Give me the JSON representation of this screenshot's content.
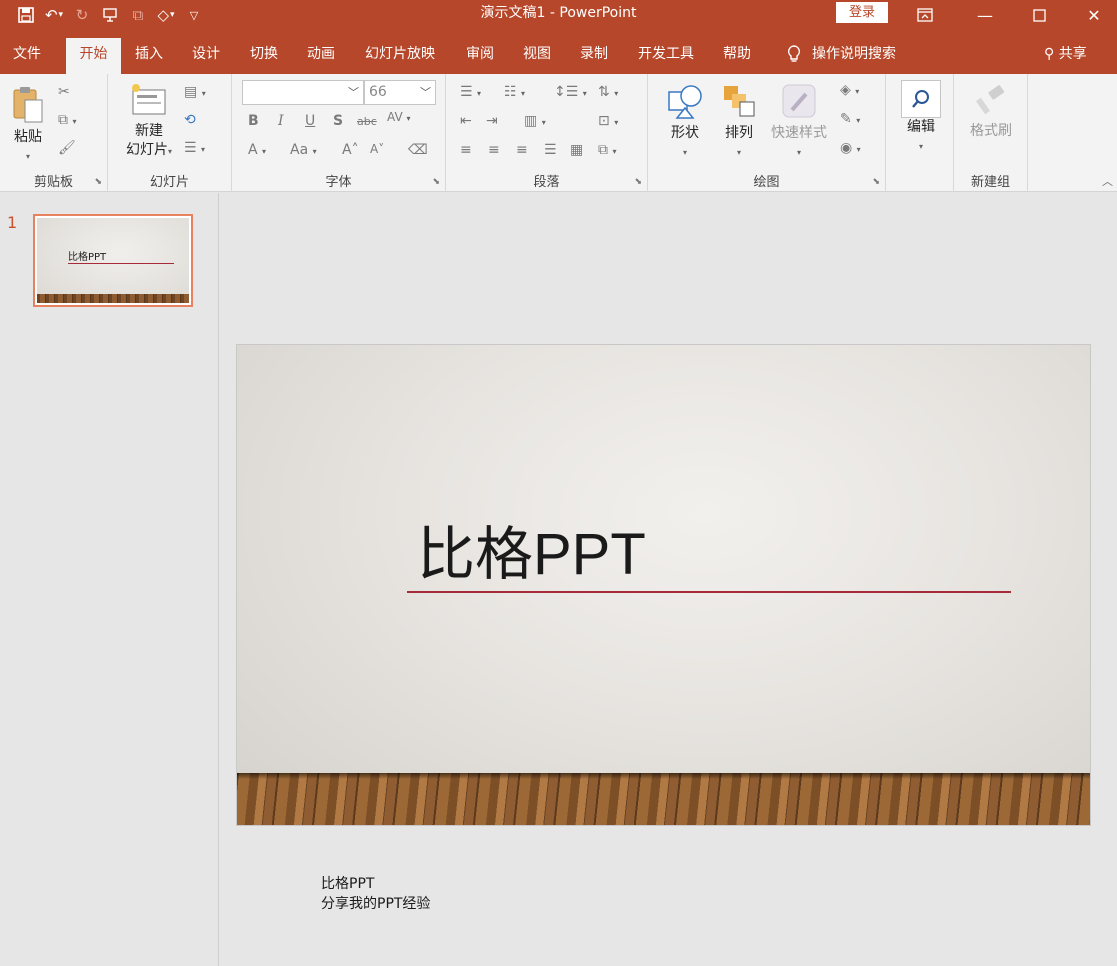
{
  "window": {
    "title": "演示文稿1  -  PowerPoint",
    "login_label": "登录"
  },
  "qat": {
    "icons": [
      "save-icon",
      "undo-icon",
      "redo-icon",
      "present-from-start-icon",
      "copy-icon",
      "shapes-icon",
      "customize-qat-icon"
    ]
  },
  "tabs": [
    {
      "label": "文件"
    },
    {
      "label": "开始"
    },
    {
      "label": "插入"
    },
    {
      "label": "设计"
    },
    {
      "label": "切换"
    },
    {
      "label": "动画"
    },
    {
      "label": "幻灯片放映"
    },
    {
      "label": "审阅"
    },
    {
      "label": "视图"
    },
    {
      "label": "录制"
    },
    {
      "label": "开发工具"
    },
    {
      "label": "帮助"
    }
  ],
  "active_tab": "开始",
  "tell_me": "操作说明搜索",
  "share": "共享",
  "ribbon": {
    "clipboard": {
      "paste": "粘贴",
      "group": "剪贴板"
    },
    "slides": {
      "new_slide_line1": "新建",
      "new_slide_line2": "幻灯片",
      "group": "幻灯片"
    },
    "font": {
      "font_name": "",
      "font_size": "66",
      "group": "字体"
    },
    "paragraph": {
      "group": "段落"
    },
    "drawing": {
      "shapes": "形状",
      "arrange": "排列",
      "quick_styles": "快速样式",
      "group": "绘图"
    },
    "editing": {
      "edit": "编辑"
    },
    "newgroup": {
      "format_painter": "格式刷",
      "group": "新建组"
    }
  },
  "thumbnails": [
    {
      "number": "1",
      "title": "比格PPT"
    }
  ],
  "slide": {
    "title": "比格PPT"
  },
  "notes": {
    "line1": "比格PPT",
    "line2": "分享我的PPT经验"
  },
  "colors": {
    "accent": "#b7472a",
    "title_underline": "#a52a3a",
    "thumb_border": "#e8825e"
  }
}
